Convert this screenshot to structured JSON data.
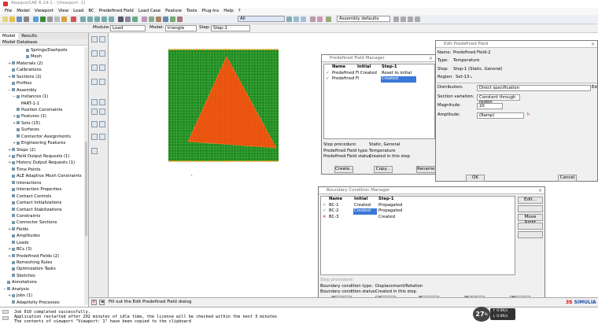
{
  "window": {
    "title": "Abaqus/CAE 6.14-1 - [Viewport: 1]"
  },
  "menu": [
    "File",
    "Model",
    "Viewport",
    "View",
    "Load",
    "BC",
    "Predefined Field",
    "Load Case",
    "Feature",
    "Tools",
    "Plug-ins",
    "Help",
    "?"
  ],
  "toolbar": {
    "render_value": "All",
    "view_style": "Assembly defaults"
  },
  "context": {
    "module_label": "Module:",
    "module_value": "Load",
    "model_label": "Model:",
    "model_value": "triangle",
    "step_label": "Step:",
    "step_value": "Step-1"
  },
  "tree": {
    "tabs": [
      "Model",
      "Results"
    ],
    "header": "Model Database",
    "items": [
      {
        "label": "Springs/Dashpots",
        "indent": 4,
        "icon": "spring-icon"
      },
      {
        "label": "Mesh",
        "indent": 4,
        "icon": "mesh-icon"
      },
      {
        "label": "Materials (2)",
        "indent": 1,
        "icon": "materials-icon",
        "expand": "+"
      },
      {
        "label": "Calibrations",
        "indent": 1,
        "icon": "calibrations-icon"
      },
      {
        "label": "Sections (2)",
        "indent": 1,
        "icon": "sections-icon",
        "expand": "+"
      },
      {
        "label": "Profiles",
        "indent": 1,
        "icon": "profiles-icon"
      },
      {
        "label": "Assembly",
        "indent": 1,
        "icon": "assembly-icon",
        "expand": "−"
      },
      {
        "label": "Instances (1)",
        "indent": 2,
        "icon": "instances-icon",
        "expand": "−"
      },
      {
        "label": "PART-1-1",
        "indent": 3,
        "icon": ""
      },
      {
        "label": "Position Constraints",
        "indent": 2,
        "icon": "constraint-icon"
      },
      {
        "label": "Features (1)",
        "indent": 2,
        "icon": "features-icon",
        "expand": "+"
      },
      {
        "label": "Sets (15)",
        "indent": 2,
        "icon": "sets-icon",
        "expand": "+"
      },
      {
        "label": "Surfaces",
        "indent": 2,
        "icon": "surfaces-icon"
      },
      {
        "label": "Connector Assignments",
        "indent": 2,
        "icon": "connector-icon"
      },
      {
        "label": "Engineering Features",
        "indent": 2,
        "icon": "engineering-icon",
        "expand": "+"
      },
      {
        "label": "Steps (2)",
        "indent": 1,
        "icon": "steps-icon",
        "expand": "+"
      },
      {
        "label": "Field Output Requests (1)",
        "indent": 1,
        "icon": "field-output-icon",
        "expand": "+"
      },
      {
        "label": "History Output Requests (1)",
        "indent": 1,
        "icon": "history-output-icon",
        "expand": "+"
      },
      {
        "label": "Time Points",
        "indent": 1,
        "icon": "time-points-icon"
      },
      {
        "label": "ALE Adaptive Mesh Constraints",
        "indent": 1,
        "icon": "ale-icon"
      },
      {
        "label": "Interactions",
        "indent": 1,
        "icon": "interactions-icon"
      },
      {
        "label": "Interaction Properties",
        "indent": 1,
        "icon": "interaction-props-icon"
      },
      {
        "label": "Contact Controls",
        "indent": 1,
        "icon": "contact-controls-icon"
      },
      {
        "label": "Contact Initializations",
        "indent": 1,
        "icon": "contact-init-icon"
      },
      {
        "label": "Contact Stabilizations",
        "indent": 1,
        "icon": "contact-stab-icon"
      },
      {
        "label": "Constraints",
        "indent": 1,
        "icon": "constraints-icon"
      },
      {
        "label": "Connector Sections",
        "indent": 1,
        "icon": "connector-sections-icon"
      },
      {
        "label": "Fields",
        "indent": 1,
        "icon": "fields-icon",
        "expand": "+"
      },
      {
        "label": "Amplitudes",
        "indent": 1,
        "icon": "amplitudes-icon"
      },
      {
        "label": "Loads",
        "indent": 1,
        "icon": "loads-icon"
      },
      {
        "label": "BCs (3)",
        "indent": 1,
        "icon": "bcs-icon",
        "expand": "+"
      },
      {
        "label": "Predefined Fields (2)",
        "indent": 1,
        "icon": "predefined-icon",
        "expand": "+"
      },
      {
        "label": "Remeshing Rules",
        "indent": 1,
        "icon": "remeshing-icon"
      },
      {
        "label": "Optimization Tasks",
        "indent": 1,
        "icon": "optimization-icon"
      },
      {
        "label": "Sketches",
        "indent": 1,
        "icon": "sketches-icon"
      },
      {
        "label": "Annotations",
        "indent": 0,
        "icon": "annotations-icon"
      },
      {
        "label": "Analysis",
        "indent": 0,
        "icon": "analysis-icon",
        "expand": "−"
      },
      {
        "label": "Jobs (1)",
        "indent": 1,
        "icon": "jobs-icon",
        "expand": "+"
      },
      {
        "label": "Adaptivity Processes",
        "indent": 1,
        "icon": "adaptivity-icon"
      }
    ]
  },
  "predef_manager": {
    "title": "Predefined Field Manager",
    "headers": [
      "Name",
      "Initial",
      "Step-1"
    ],
    "rows": [
      {
        "name": "Predefined Fi Created",
        "initial": "",
        "step": "Reset to initial"
      },
      {
        "name": "Predefined Fi",
        "initial": "",
        "step": "Created"
      }
    ],
    "info": [
      {
        "label": "Step procedure:",
        "value": "Static, General"
      },
      {
        "label": "Predefined Field type:",
        "value": "Temperature"
      },
      {
        "label": "Predefined Field status:",
        "value": "Created in this step"
      }
    ],
    "buttons": [
      "Create...",
      "Copy...",
      "Rename..."
    ]
  },
  "edit_field": {
    "title": "Edit Predefined Field",
    "name_label": "Name:",
    "name_value": "Predefined Field-2",
    "type_label": "Type:",
    "type_value": "Temperature",
    "step_label": "Step:",
    "step_value": "Step-1 (Static, General)",
    "region_label": "Region:",
    "region_value": "Set-13",
    "distribution_label": "Distribution:",
    "distribution_value": "Direct specification",
    "section_label": "Section variation:",
    "section_value": "Constant through region",
    "magnitude_label": "Magnitude:",
    "magnitude_value": "20",
    "amplitude_label": "Amplitude:",
    "amplitude_value": "(Ramp)",
    "ext_label": "Ed",
    "ok": "OK",
    "cancel": "Cancel"
  },
  "bc_manager": {
    "title": "Boundary Condition Manager",
    "headers": [
      "Name",
      "Initial",
      "Step-1"
    ],
    "rows": [
      {
        "mark": "✓",
        "name": "BC-1",
        "initial": "Created",
        "step": "Propagated"
      },
      {
        "mark": "✓",
        "name": "BC-2",
        "initial": "Created",
        "step": "Propagated"
      },
      {
        "mark": "✕",
        "name": "BC-3",
        "initial": "",
        "step": "Created"
      }
    ],
    "side_buttons": [
      "Edit...",
      "Move Left",
      "Move Right",
      "Activate",
      "Deactivate"
    ],
    "info": [
      {
        "label": "Step procedure:",
        "value": ""
      },
      {
        "label": "Boundary condition type:",
        "value": "Displacement/Rotation"
      },
      {
        "label": "Boundary condition status:",
        "value": "Created in this step"
      }
    ],
    "buttons": [
      "Create...",
      "Copy...",
      "Rename...",
      "Delete...",
      "Dismiss"
    ]
  },
  "prompt": "Fill out the Edit Predefined Field dialog",
  "messages": [
    "Job 010 completed successfully.",
    "Application restarted after 292 minutes of idle time, the license will be checked within the next 3 minutes",
    "The contents of viewport \"Viewport: 1\" have been copied to the clipboard"
  ],
  "badge": {
    "value": "27",
    "sup": "%"
  },
  "net": {
    "up": "0.0K/s",
    "down": "0.0K/s"
  },
  "brand": "SIMULIA"
}
